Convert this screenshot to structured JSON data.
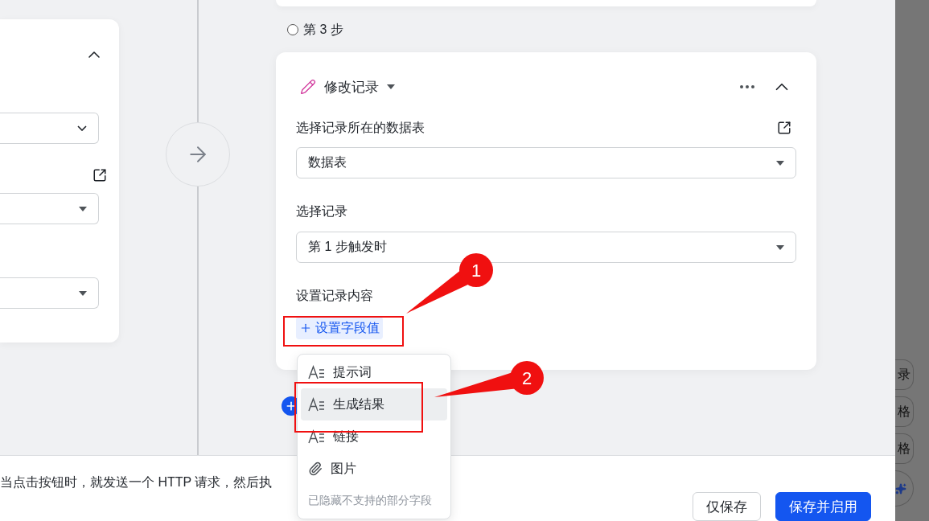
{
  "step": {
    "label": "第 3 步"
  },
  "action_card": {
    "title": "修改记录",
    "table_label": "选择记录所在的数据表",
    "table_select": "数据表",
    "record_label": "选择记录",
    "record_select": "第 1 步触发时",
    "content_label": "设置记录内容",
    "add_field_button": "设置字段值"
  },
  "field_menu": {
    "items": [
      {
        "label": "提示词",
        "kind": "text",
        "selected": false
      },
      {
        "label": "生成结果",
        "kind": "text",
        "selected": true
      },
      {
        "label": "链接",
        "kind": "text",
        "selected": false
      },
      {
        "label": "图片",
        "kind": "attachment",
        "selected": false
      }
    ],
    "note": "已隐藏不支持的部分字段"
  },
  "footer": {
    "description": "当点击按钮时，就发送一个 HTTP 请求，然后执",
    "buttons": [
      {
        "label": "仅保存",
        "kind": "secondary"
      },
      {
        "label": "保存并启用",
        "kind": "primary"
      }
    ]
  },
  "side_buttons": [
    {
      "label": "录"
    },
    {
      "label": "格"
    },
    {
      "label": "格"
    }
  ],
  "annotations": [
    {
      "label": "1"
    },
    {
      "label": "2"
    }
  ]
}
